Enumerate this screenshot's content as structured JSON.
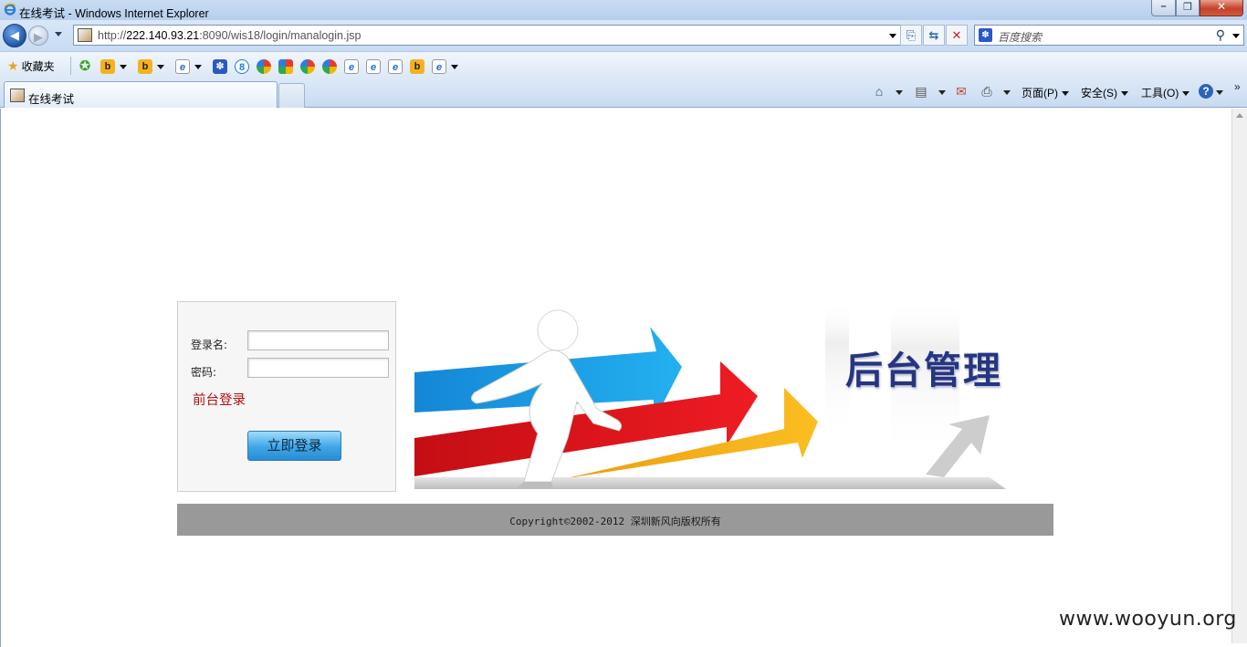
{
  "window": {
    "title": "在线考试 - Windows Internet Explorer"
  },
  "address": {
    "url_prefix": "http://",
    "url_host": "222.140.93.21",
    "url_rest": ":8090/wis18/login/manalogin.jsp"
  },
  "search": {
    "placeholder": "百度搜索"
  },
  "favorites": {
    "label": "收藏夹"
  },
  "tab": {
    "label": "在线考试"
  },
  "commandbar": {
    "page_label": "页面(P)",
    "safety_label": "安全(S)",
    "tools_label": "工具(O)"
  },
  "login": {
    "username_label": "登录名:",
    "password_label": "密码:",
    "front_login_link": "前台登录",
    "submit_label": "立即登录",
    "username_value": "",
    "password_value": ""
  },
  "banner": {
    "title": "后台管理"
  },
  "footer": {
    "copyright": "Copyright©2002-2012 深圳新风向版权所有"
  },
  "watermark": "www.wooyun.org",
  "colors": {
    "banner_title": "#263580",
    "link_red": "#b01010",
    "button_blue": "#3ea6e8",
    "footer_gray": "#999999",
    "arrow_blue": "#1aa3e6",
    "arrow_red": "#e2161b",
    "arrow_yellow": "#f7b21a"
  }
}
